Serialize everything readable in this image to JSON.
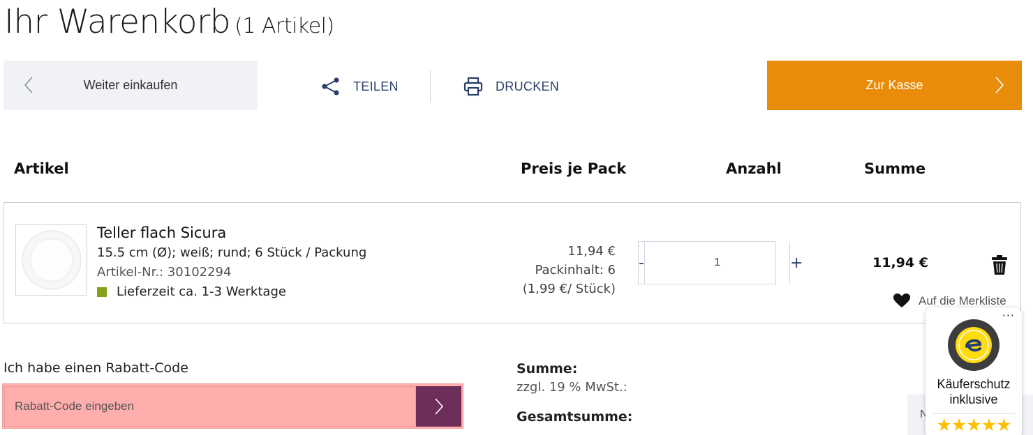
{
  "header": {
    "title": "Ihr Warenkorb",
    "item_count": "(1 Artikel)"
  },
  "toolbar": {
    "continue_label": "Weiter einkaufen",
    "share_label": "TEILEN",
    "print_label": "DRUCKEN",
    "checkout_label": "Zur Kasse"
  },
  "table": {
    "columns": [
      "Artikel",
      "Preis je Pack",
      "Anzahl",
      "Summe"
    ]
  },
  "cart": {
    "items": [
      {
        "name": "Teller flach Sicura",
        "description": "15.5 cm (Ø); weiß; rund; 6 Stück / Packung",
        "sku": "Artikel-Nr.: 30102294",
        "delivery": "Lieferzeit ca. 1-3 Werktage",
        "price": "11,94 €",
        "pack_content": "Packinhalt: 6",
        "unit_price": "(1,99 €/ Stück)",
        "quantity": "1",
        "minus_label": "-",
        "plus_label": "+",
        "line_total": "11,94 €",
        "wishlist_label": "Auf die Merkliste"
      }
    ]
  },
  "coupon": {
    "label": "Ich habe einen Rabatt-Code",
    "placeholder": "Rabatt-Code eingeben"
  },
  "summary": {
    "sum_label": "Summe:",
    "vat_label": "zzgl. 19 % MwSt.:",
    "grand_total_label": "Gesamtsumme:"
  },
  "side_tab": {
    "label": "N"
  },
  "trust_badge": {
    "more_label": "···",
    "text_line1": "Käuferschutz",
    "text_line2": "inklusive",
    "stars": "★★★★★",
    "rating": 5
  },
  "colors": {
    "checkout": "#e88c0a",
    "coupon_button": "#6e2e5a",
    "delivery_status": "#86a01c",
    "link_blue": "#2b3e6b",
    "highlight": "#ffadad"
  }
}
